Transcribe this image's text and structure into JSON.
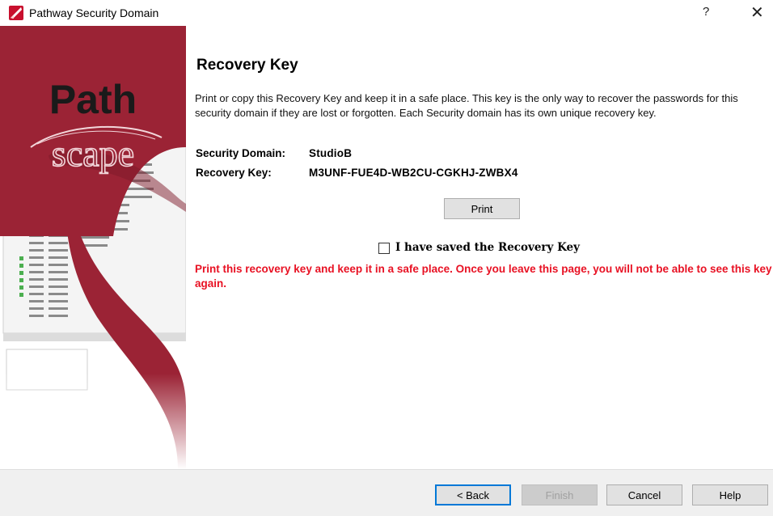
{
  "window": {
    "title": "Pathway Security Domain",
    "help_glyph": "?",
    "close_glyph": "✕"
  },
  "banner": {
    "logo_top": "Path",
    "logo_bottom": "scape",
    "bg_color": "#9b2335"
  },
  "page": {
    "heading": "Recovery Key",
    "intro": "Print or copy this Recovery Key and keep it in a safe place. This key is the only way to recover the passwords for this security domain if they are lost or forgotten.  Each Security domain has its own unique recovery key.",
    "domain_label": "Security Domain:",
    "domain_value": "StudioB",
    "key_label": "Recovery Key:",
    "key_value": "M3UNF-FUE4D-WB2CU-CGKHJ-ZWBX4",
    "print_label": "Print",
    "checkbox_label": "I have saved the Recovery Key",
    "checkbox_checked": false,
    "warning": "Print this recovery key and keep it in a safe place.  Once you leave this page, you will not be able to see this key again.",
    "warning_color": "#e81123"
  },
  "footer": {
    "back_label": "< Back",
    "finish_label": "Finish",
    "cancel_label": "Cancel",
    "help_label": "Help"
  }
}
